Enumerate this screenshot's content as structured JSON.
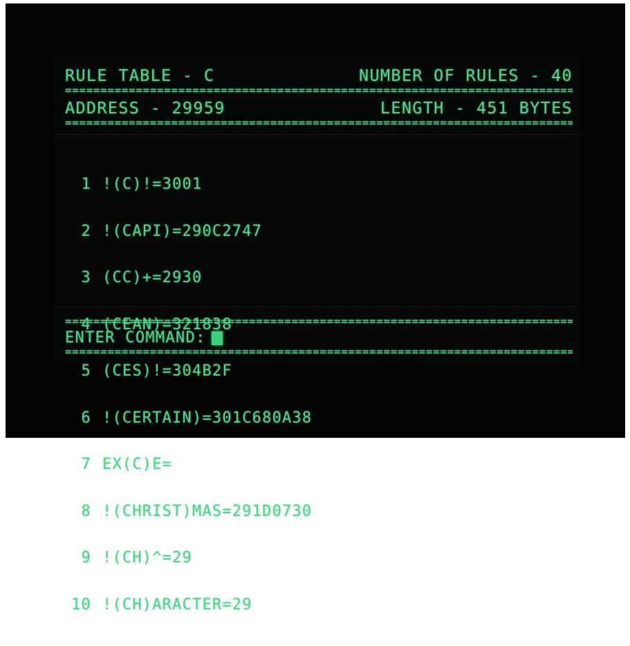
{
  "header": {
    "table_label": "RULE TABLE - C",
    "rule_count_label": "NUMBER OF RULES - 40",
    "address_label": "ADDRESS - 29959",
    "length_label": "LENGTH - 451 BYTES"
  },
  "separator": "==============================================================================================",
  "rules": [
    {
      "num": "1",
      "text": "!(C)!=3001"
    },
    {
      "num": "2",
      "text": "!(CAPI)=290C2747"
    },
    {
      "num": "3",
      "text": "(CC)+=2930"
    },
    {
      "num": "4",
      "text": "(CEAN)=321838"
    },
    {
      "num": "5",
      "text": "(CES)!=304B2F"
    },
    {
      "num": "6",
      "text": "!(CERTAIN)=301C680A38"
    },
    {
      "num": "7",
      "text": "EX(C)E="
    },
    {
      "num": "8",
      "text": "!(CHRIST)MAS=291D0730"
    },
    {
      "num": "9",
      "text": "!(CH)^=29"
    },
    {
      "num": "10",
      "text": "!(CH)ARACTER=29"
    }
  ],
  "command": {
    "prompt": "ENTER COMMAND:"
  },
  "colors": {
    "phosphor_green": "#4fd48c",
    "cursor_green": "#3bd47e",
    "screen_black": "#050807"
  }
}
